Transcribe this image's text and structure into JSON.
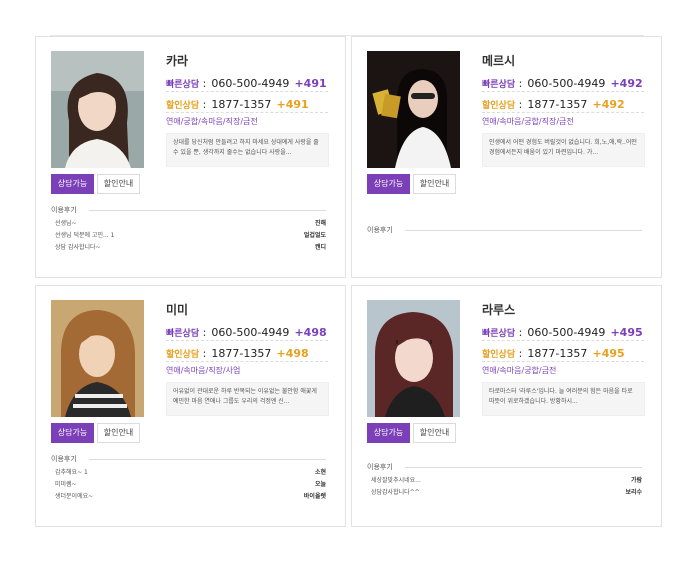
{
  "labels": {
    "fast_consult": "빠른상담",
    "discount_consult": "할인상담",
    "consult_available": "상담가능",
    "discount_info": "할인안내",
    "reviews": "이용후기",
    "colon": " :"
  },
  "counselors": [
    {
      "name": "카라",
      "fast_phone": "060-500-4949",
      "fast_code": "+491",
      "discount_phone": "1877-1357",
      "discount_code": "+491",
      "tags": "연애/궁합/속마음/직장/금전",
      "description": "상대를 당신처럼 만들려고 하지 마세요 상대에게 사랑을 줄 수 있을 뿐, 생각까지 줄수는 없습니다 사랑을...",
      "reviews": [
        {
          "text": "선생님~",
          "author": "진해"
        },
        {
          "text": "선생님 덕분에 고민... 1",
          "author": "얼겁얼도"
        },
        {
          "text": "상담 감사합니다~",
          "author": "캔디"
        }
      ]
    },
    {
      "name": "메르시",
      "fast_phone": "060-500-4949",
      "fast_code": "+492",
      "discount_phone": "1877-1357",
      "discount_code": "+492",
      "tags": "연애/속마음/궁합/직장/금전",
      "description": "인생에서 어떤 경험도 버릴것이 없습니다. 희,노,애,락..어떤 경험에서든지 배움이 있기 마련입니다. 가...",
      "reviews": []
    },
    {
      "name": "미미",
      "fast_phone": "060-500-4949",
      "fast_code": "+498",
      "discount_phone": "1877-1357",
      "discount_code": "+498",
      "tags": "연애/속마음/직장/사업",
      "description": "어유없이 관대로운 하루 반복되는 이유없는 불안함 애꿎게 예민한 마음 연애나 그룹도 우리의 걱정엔 신...",
      "reviews": [
        {
          "text": "감추해요~ 1",
          "author": "소현"
        },
        {
          "text": "미미쌤~",
          "author": "오늘"
        },
        {
          "text": "생더분이에요~",
          "author": "바이올렛"
        }
      ]
    },
    {
      "name": "라루스",
      "fast_phone": "060-500-4949",
      "fast_code": "+495",
      "discount_phone": "1877-1357",
      "discount_code": "+495",
      "tags": "연애/속마음/궁합/금전",
      "description": "타로마스터 '라루스'입니다. 늘 여러분의 험든 마음을 타로 따뜻이 위로하겠습니다. 방황하시...",
      "reviews": [
        {
          "text": "세상잘맞추시네요...",
          "author": "가람"
        },
        {
          "text": "상담감사합니다^^",
          "author": "보리수"
        }
      ]
    }
  ],
  "colors": {
    "purple": "#7b3fb8",
    "orange": "#e8a020"
  }
}
